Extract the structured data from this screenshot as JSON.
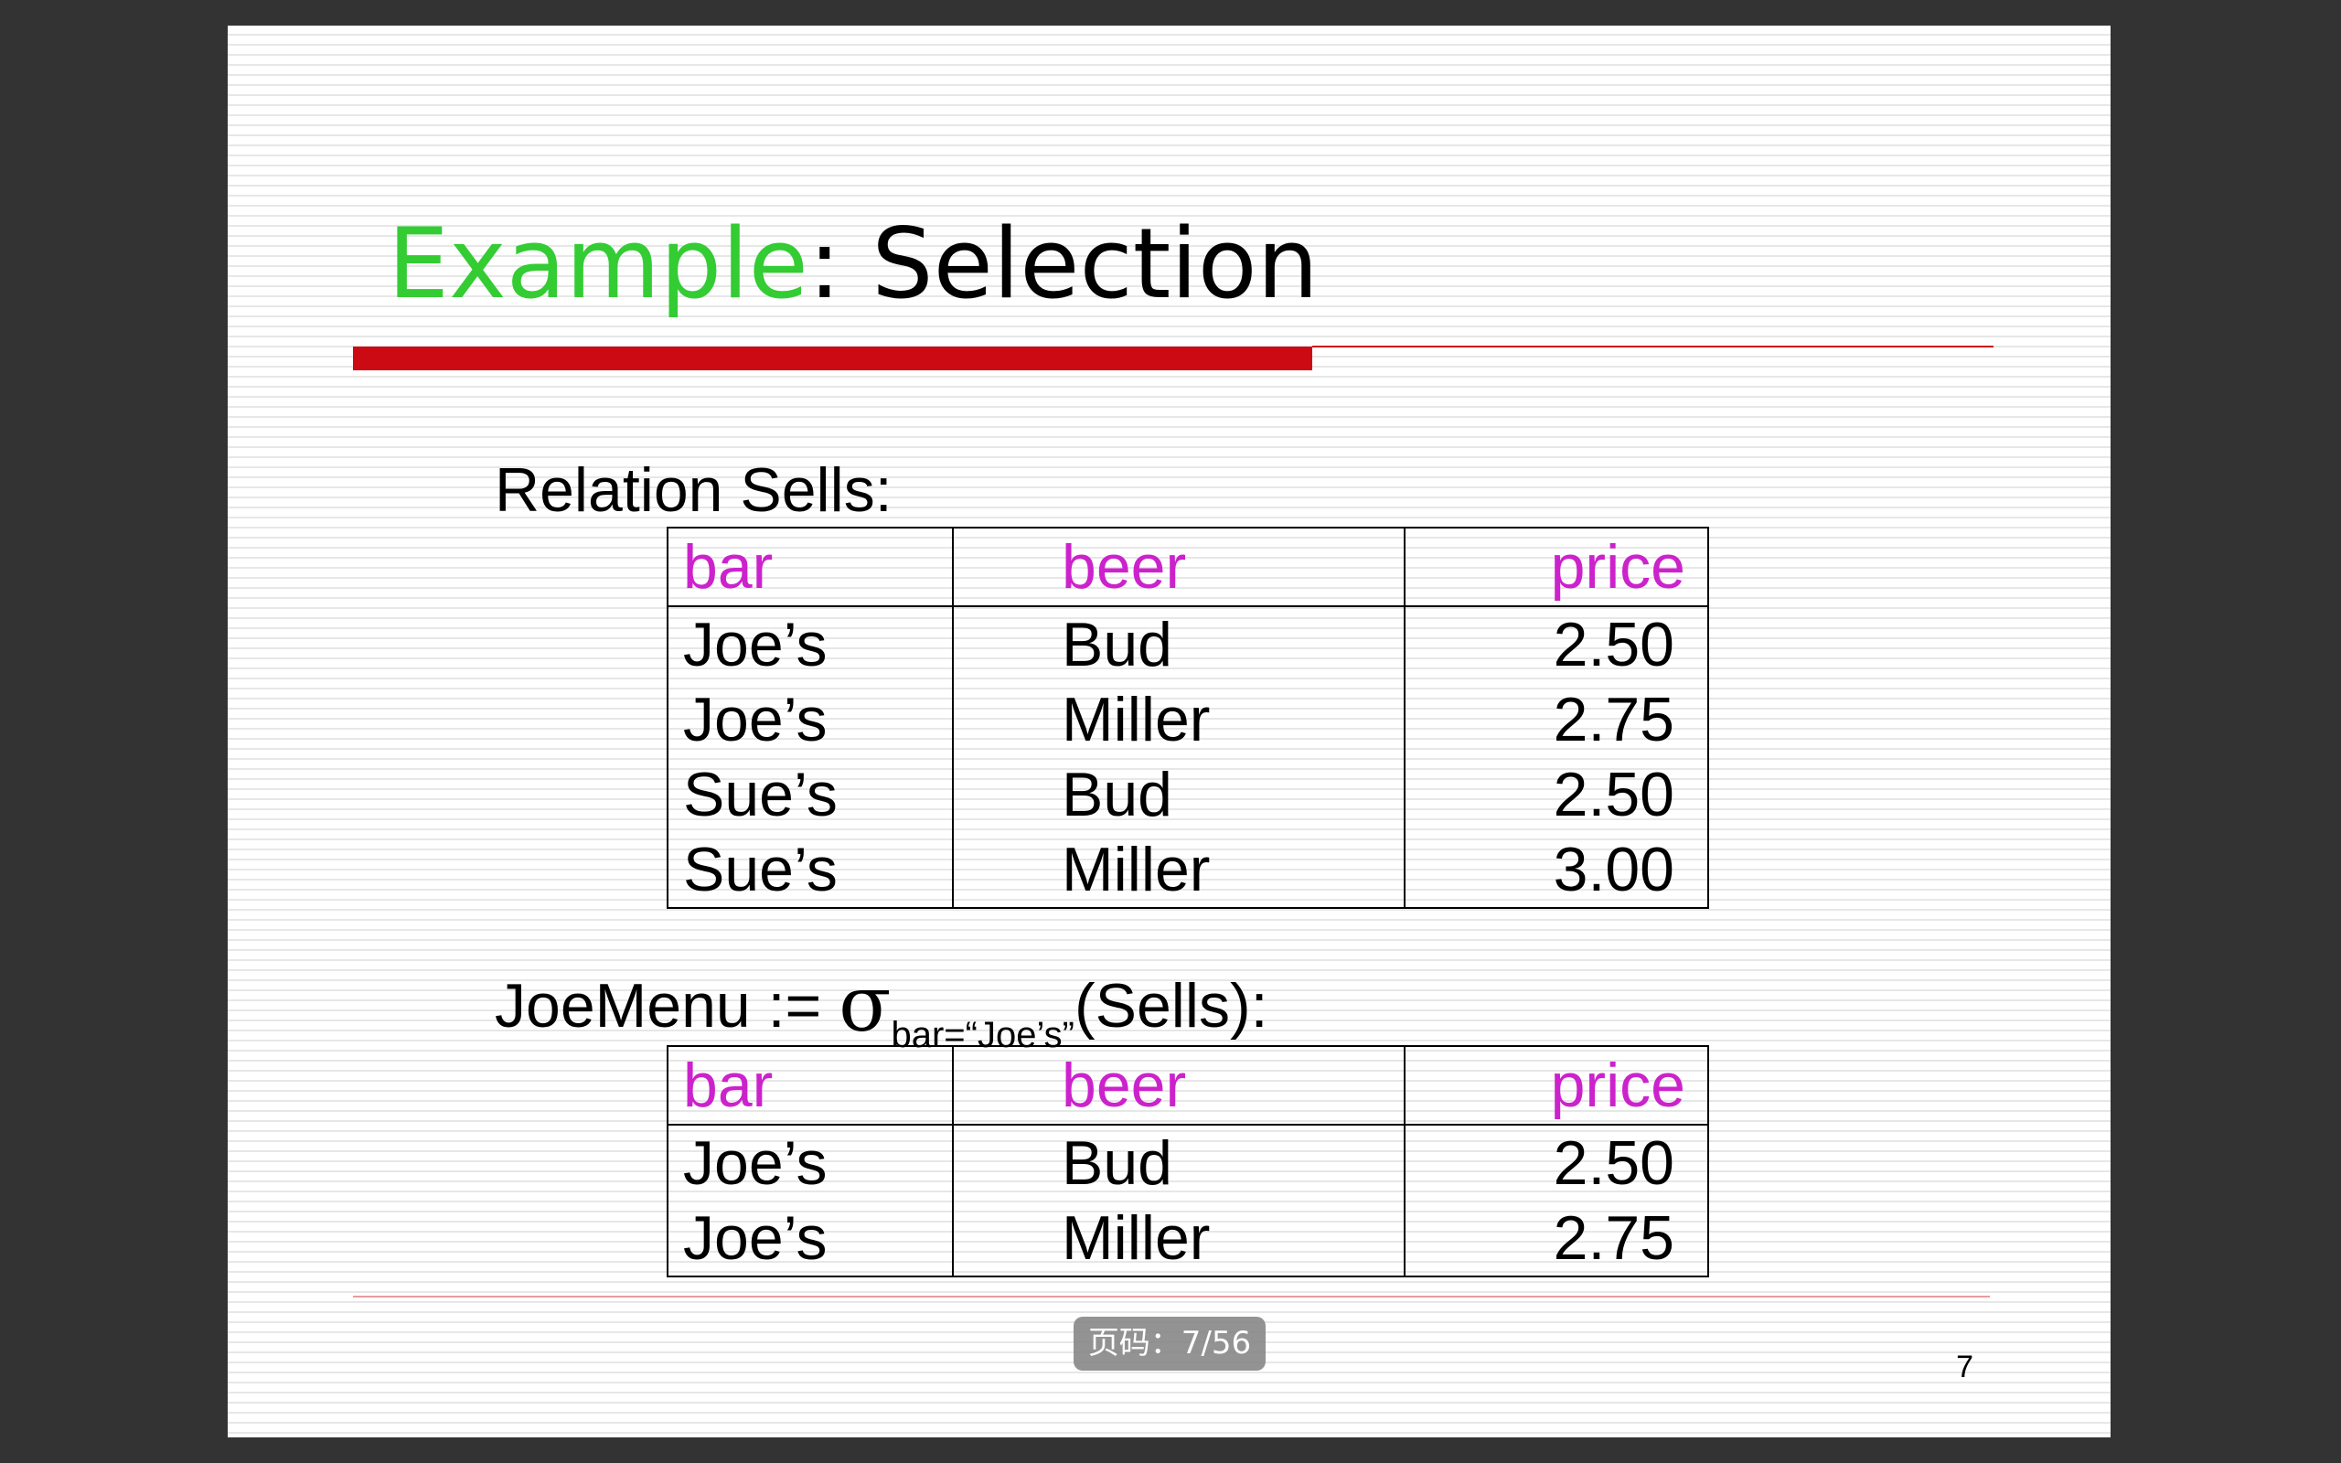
{
  "slide": {
    "title_accent": "Example",
    "title_rest": ": Selection",
    "relation_label": "Relation Sells:",
    "expression": {
      "prefix": "JoeMenu := ",
      "sigma": "σ",
      "subscript": "bar=“Joe’s”",
      "suffix": "(Sells):"
    },
    "sells_table": {
      "headers": [
        "bar",
        "beer",
        "price"
      ],
      "rows": [
        [
          "Joe’s",
          "Bud",
          "2.50"
        ],
        [
          "Joe’s",
          "Miller",
          "2.75"
        ],
        [
          "Sue’s",
          "Bud",
          "2.50"
        ],
        [
          "Sue’s",
          "Miller",
          "3.00"
        ]
      ]
    },
    "joemenu_table": {
      "headers": [
        "bar",
        "beer",
        "price"
      ],
      "rows": [
        [
          "Joe’s",
          "Bud",
          "2.50"
        ],
        [
          "Joe’s",
          "Miller",
          "2.75"
        ]
      ]
    },
    "slide_number": "7"
  },
  "viewer": {
    "page_indicator": "页码：7/56"
  },
  "colors": {
    "title_accent": "#33cc33",
    "header_text": "#cc22cc",
    "title_bar": "#cc0a14",
    "viewer_background": "#333333"
  }
}
